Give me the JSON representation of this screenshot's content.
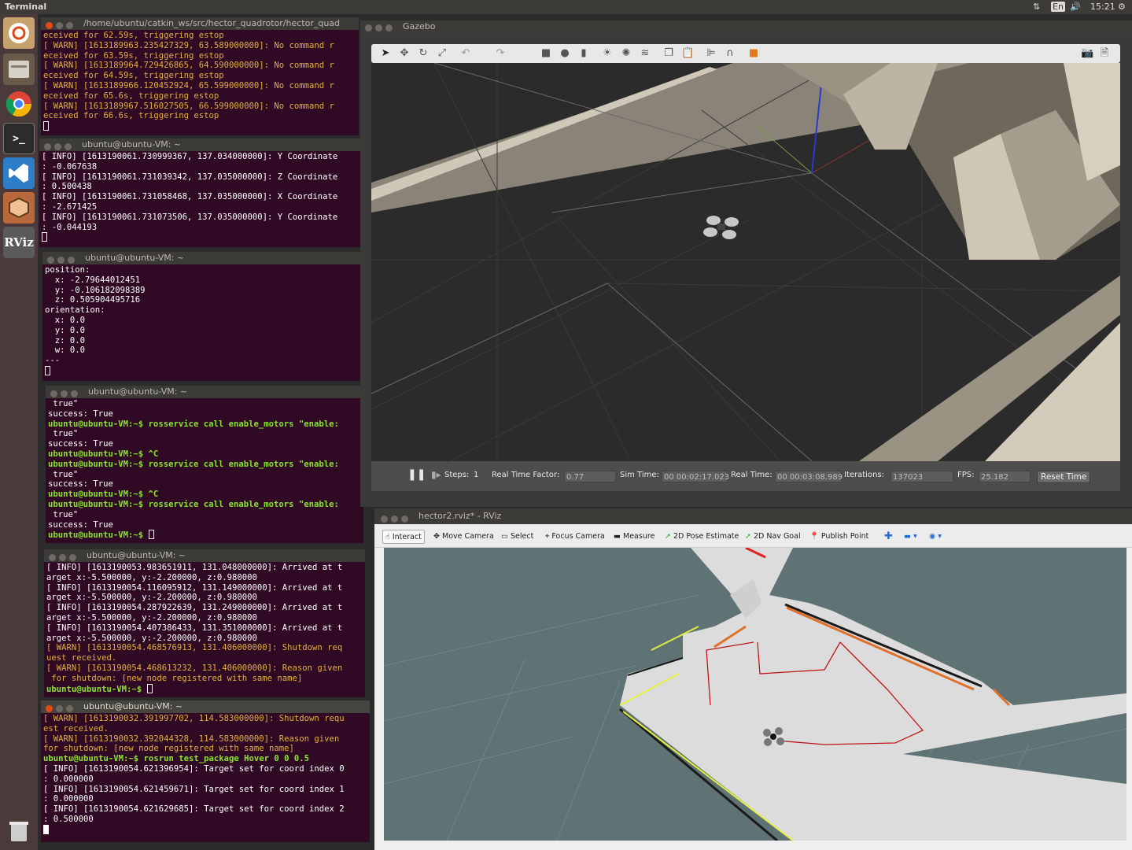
{
  "topbar": {
    "title": "Terminal",
    "lang": "En",
    "clock": "15:21"
  },
  "launcher": {
    "rviz_label": "RViz"
  },
  "terminals": [
    {
      "title": "/home/ubuntu/catkin_ws/src/hector_quadrotor/hector_quad",
      "lines": [
        "eceived for 62.59s, triggering estop",
        "[ WARN] [1613189963.235427329, 63.589000000]: No command r",
        "eceived for 63.59s, triggering estop",
        "[ WARN] [1613189964.729426865, 64.590000000]: No command r",
        "eceived for 64.59s, triggering estop",
        "[ WARN] [1613189966.120452924, 65.599000000]: No command r",
        "eceived for 65.6s, triggering estop",
        "[ WARN] [1613189967.516027505, 66.599000000]: No command r",
        "eceived for 66.6s, triggering estop"
      ]
    },
    {
      "title": "ubuntu@ubuntu-VM: ~",
      "lines": [
        "[ INFO] [1613190061.730999367, 137.034000000]: Y Coordinate",
        ": -0.067638",
        "[ INFO] [1613190061.731039342, 137.035000000]: Z Coordinate",
        ": 0.500438",
        "[ INFO] [1613190061.731058468, 137.035000000]: X Coordinate",
        ": -2.671425",
        "[ INFO] [1613190061.731073506, 137.035000000]: Y Coordinate",
        ": -0.044193"
      ]
    },
    {
      "title": "ubuntu@ubuntu-VM: ~",
      "lines": [
        "position:",
        "  x: -2.79644012451",
        "  y: -0.106182098389",
        "  z: 0.505904495716",
        "orientation:",
        "  x: 0.0",
        "  y: 0.0",
        "  z: 0.0",
        "  w: 0.0",
        "---"
      ]
    },
    {
      "title": "ubuntu@ubuntu-VM: ~",
      "lines": [
        " true\"",
        "success: True",
        "ubuntu@ubuntu-VM:~$ rosservice call enable_motors \"enable:",
        " true\"",
        "success: True",
        "ubuntu@ubuntu-VM:~$ ^C",
        "ubuntu@ubuntu-VM:~$ rosservice call enable_motors \"enable:",
        " true\"",
        "success: True",
        "ubuntu@ubuntu-VM:~$ ^C",
        "ubuntu@ubuntu-VM:~$ rosservice call enable_motors \"enable:",
        " true\"",
        "success: True",
        "ubuntu@ubuntu-VM:~$ "
      ]
    },
    {
      "title": "ubuntu@ubuntu-VM: ~",
      "lines": [
        "[ INFO] [1613190053.983651911, 131.048000000]: Arrived at t",
        "arget x:-5.500000, y:-2.200000, z:0.980000",
        "[ INFO] [1613190054.116095912, 131.149000000]: Arrived at t",
        "arget x:-5.500000, y:-2.200000, z:0.980000",
        "[ INFO] [1613190054.287922639, 131.249000000]: Arrived at t",
        "arget x:-5.500000, y:-2.200000, z:0.980000",
        "[ INFO] [1613190054.407386433, 131.351000000]: Arrived at t",
        "arget x:-5.500000, y:-2.200000, z:0.980000",
        "[ WARN] [1613190054.468576913, 131.406000000]: Shutdown req",
        "uest received.",
        "[ WARN] [1613190054.468613232, 131.406000000]: Reason given",
        " for shutdown: [new node registered with same name]",
        "ubuntu@ubuntu-VM:~$ "
      ]
    },
    {
      "title": "ubuntu@ubuntu-VM: ~",
      "lines": [
        "[ WARN] [1613190032.391997702, 114.583000000]: Shutdown requ",
        "est received.",
        "[ WARN] [1613190032.392044328, 114.583000000]: Reason given",
        "for shutdown: [new node registered with same name]",
        "ubuntu@ubuntu-VM:~$ rosrun test_package Hover 0 0 0.5",
        "[ INFO] [1613190054.621396954]: Target set for coord index 0",
        ": 0.000000",
        "[ INFO] [1613190054.621459671]: Target set for coord index 1",
        ": 0.000000",
        "[ INFO] [1613190054.621629685]: Target set for coord index 2",
        ": 0.500000"
      ]
    }
  ],
  "gazebo": {
    "title": "Gazebo",
    "steps_label": "Steps:",
    "steps_value": "1",
    "rtf_label": "Real Time Factor:",
    "rtf_value": "0.77",
    "simtime_label": "Sim Time:",
    "simtime_value": "00 00:02:17.023",
    "realtime_label": "Real Time:",
    "realtime_value": "00 00:03:08.989",
    "iterations_label": "Iterations:",
    "iterations_value": "137023",
    "fps_label": "FPS:",
    "fps_value": "25.182",
    "reset_label": "Reset Time"
  },
  "rviz": {
    "title": "hector2.rviz* - RViz",
    "tools": {
      "interact": "Interact",
      "move_camera": "Move Camera",
      "select": "Select",
      "focus_camera": "Focus Camera",
      "measure": "Measure",
      "pose_estimate": "2D Pose Estimate",
      "nav_goal": "2D Nav Goal",
      "publish_point": "Publish Point"
    }
  },
  "colors": {
    "terminal_bg": "#300a24",
    "warn": "#e0b040",
    "prompt": "#8ae234",
    "path_red": "#c0161a",
    "wall_yellow": "#e6f03c",
    "wall_orange": "#e0702a"
  }
}
